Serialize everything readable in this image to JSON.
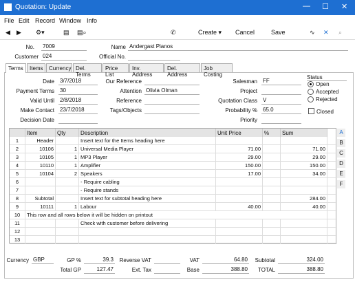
{
  "window": {
    "title": "Quotation: Update",
    "minimize": "—",
    "maximize": "☐",
    "close": "✕"
  },
  "menu": [
    "File",
    "Edit",
    "Record",
    "Window",
    "Info"
  ],
  "toolbar": {
    "create": "Create",
    "cancel": "Cancel",
    "save": "Save"
  },
  "header": {
    "no_label": "No.",
    "no": "7009",
    "name_label": "Name",
    "name": "Andergast Pianos",
    "customer_label": "Customer",
    "customer": "024",
    "official_label": "Official No.",
    "official": ""
  },
  "tabs": [
    "Terms",
    "Items",
    "Currency",
    "Del. Terms",
    "Price List",
    "Inv. Address",
    "Del. Address",
    "Job Costing"
  ],
  "terms": {
    "date_label": "Date",
    "date": "3/7/2018",
    "payterms_label": "Payment Terms",
    "payterms": "30",
    "valid_label": "Valid Until",
    "valid": "2/8/2018",
    "make_label": "Make Contact",
    "make": "23/7/2018",
    "decision_label": "Decision Date",
    "decision": "",
    "ourref_label": "Our Reference",
    "ourref": "",
    "attention_label": "Attention",
    "attention": "Olivia Olman",
    "reference_label": "Reference",
    "reference": "",
    "tags_label": "Tags/Objects",
    "tags": "",
    "salesman_label": "Salesman",
    "salesman": "FF",
    "project_label": "Project",
    "project": "",
    "qclass_label": "Quotation Class",
    "qclass": "V",
    "prob_label": "Probability %",
    "prob": "65.0",
    "priority_label": "Priority",
    "priority": ""
  },
  "status": {
    "label": "Status",
    "open": "Open",
    "accepted": "Accepted",
    "rejected": "Rejected",
    "closed": "Closed"
  },
  "grid": {
    "headers": [
      "Item",
      "Qty",
      "Description",
      "Unit Price",
      "%",
      "Sum"
    ],
    "rows": [
      {
        "n": "1",
        "item": "Header",
        "qty": "",
        "desc": "Insert text for the Items heading here",
        "price": "",
        "pct": "",
        "sum": ""
      },
      {
        "n": "2",
        "item": "10106",
        "qty": "1",
        "desc": "Universal Media Player",
        "price": "71.00",
        "pct": "",
        "sum": "71.00"
      },
      {
        "n": "3",
        "item": "10105",
        "qty": "1",
        "desc": "MP3 Player",
        "price": "29.00",
        "pct": "",
        "sum": "29.00"
      },
      {
        "n": "4",
        "item": "10110",
        "qty": "1",
        "desc": "Amplifier",
        "price": "150.00",
        "pct": "",
        "sum": "150.00"
      },
      {
        "n": "5",
        "item": "10104",
        "qty": "2",
        "desc": "Speakers",
        "price": "17.00",
        "pct": "",
        "sum": "34.00"
      },
      {
        "n": "6",
        "item": "",
        "qty": "",
        "desc": "- Require cabling",
        "price": "",
        "pct": "",
        "sum": ""
      },
      {
        "n": "7",
        "item": "",
        "qty": "",
        "desc": "- Require stands",
        "price": "",
        "pct": "",
        "sum": ""
      },
      {
        "n": "8",
        "item": "Subtotal",
        "qty": "",
        "desc": "Insert text for subtotal heading here",
        "price": "",
        "pct": "",
        "sum": "284.00"
      },
      {
        "n": "9",
        "item": "10111",
        "qty": "1",
        "desc": "Labour",
        "price": "40.00",
        "pct": "",
        "sum": "40.00"
      },
      {
        "n": "10",
        "item": "This row and all rows below it will be hidden on printout",
        "qty": "",
        "desc": "",
        "price": "",
        "pct": "",
        "sum": ""
      },
      {
        "n": "11",
        "item": "",
        "qty": "",
        "desc": "Check with customer before delivering",
        "price": "",
        "pct": "",
        "sum": ""
      },
      {
        "n": "12",
        "item": "",
        "qty": "",
        "desc": "",
        "price": "",
        "pct": "",
        "sum": ""
      },
      {
        "n": "13",
        "item": "",
        "qty": "",
        "desc": "",
        "price": "",
        "pct": "",
        "sum": ""
      }
    ],
    "side": [
      "A",
      "B",
      "C",
      "D",
      "E",
      "F"
    ]
  },
  "footer": {
    "currency_label": "Currency",
    "currency": "GBP",
    "gp_label": "GP %",
    "gp": "39.3",
    "totalgp_label": "Total GP",
    "totalgp": "127.47",
    "revvat_label": "Reverse VAT",
    "revvat": "",
    "exttax_label": "Ext. Tax",
    "exttax": "",
    "vat_label": "VAT",
    "vat": "64.80",
    "base_label": "Base",
    "base": "388.80",
    "subtotal_label": "Subtotal",
    "subtotal": "324.00",
    "total_label": "TOTAL",
    "total": "388.80"
  }
}
